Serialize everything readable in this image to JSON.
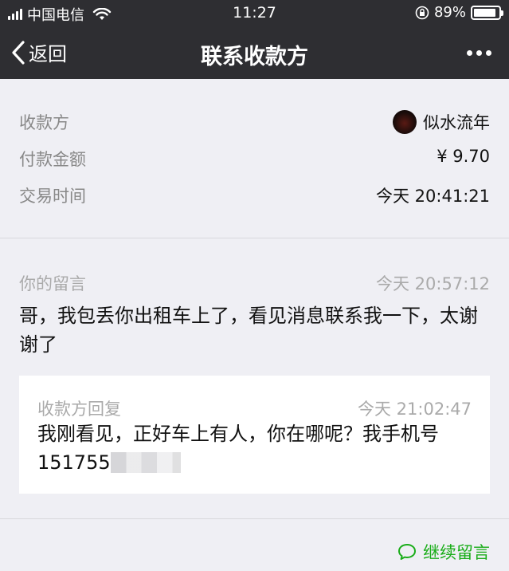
{
  "status_bar": {
    "carrier": "中国电信",
    "time": "11:27",
    "battery": "89%",
    "battery_level": 0.89
  },
  "nav": {
    "back_label": "返回",
    "title": "联系收款方"
  },
  "details": [
    {
      "label": "收款方",
      "value": "似水流年"
    },
    {
      "label": "付款金额",
      "value": "¥ 9.70"
    },
    {
      "label": "交易时间",
      "value": "今天 20:41:21"
    }
  ],
  "message": {
    "label": "你的留言",
    "time": "今天 20:57:12",
    "text": "哥，我包丢你出租车上了，看见消息联系我一下，太谢谢了"
  },
  "reply": {
    "label": "收款方回复",
    "time": "今天 21:02:47",
    "text_line1": "我刚看见，正好车上有人，你在哪呢？我手机号",
    "text_phone_visible": "151755"
  },
  "continue_label": "继续留言",
  "colors": {
    "bar": "#2e2e32",
    "background": "#efeff4",
    "accent_green": "#1aad19"
  }
}
